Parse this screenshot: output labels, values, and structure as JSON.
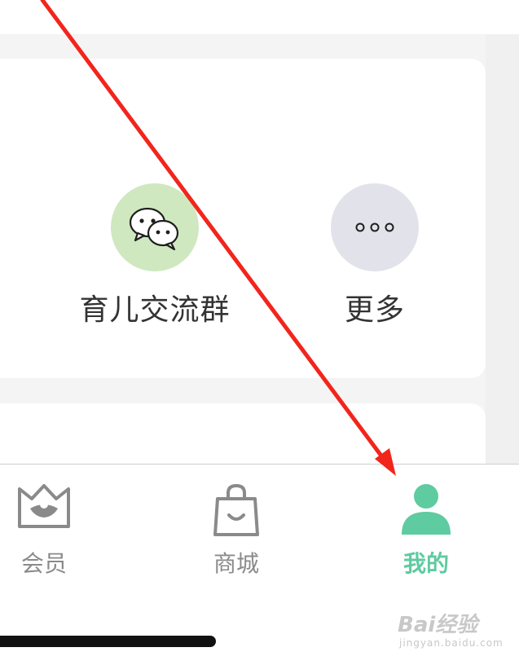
{
  "colors": {
    "accent": "#5ecba0",
    "wechat_circle": "#cfe8c0",
    "more_circle": "#e2e2ea",
    "tab_inactive": "#8a8a8a",
    "annotation_arrow": "#f2251c"
  },
  "services": {
    "items": [
      {
        "label": "育儿交流群",
        "icon": "wechat-icon"
      },
      {
        "label": "更多",
        "icon": "more-dots-icon"
      }
    ]
  },
  "tabbar": {
    "items": [
      {
        "label": "会员",
        "icon": "crown-icon",
        "active": false
      },
      {
        "label": "商城",
        "icon": "shopping-bag-icon",
        "active": false
      },
      {
        "label": "我的",
        "icon": "person-icon",
        "active": true
      }
    ]
  },
  "watermark": {
    "brand": "Bai经验",
    "sub": "jingyan.baidu.com"
  }
}
